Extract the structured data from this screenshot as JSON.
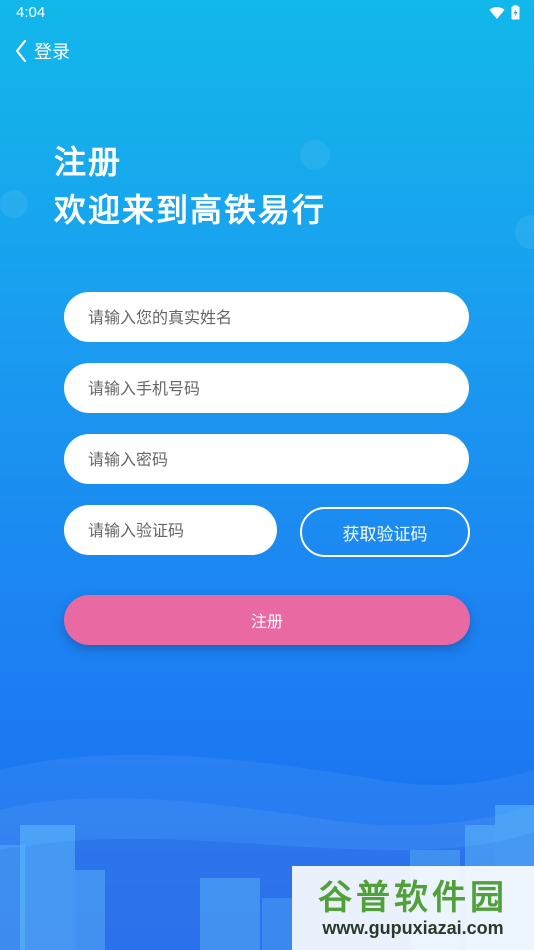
{
  "status_bar": {
    "time": "4:04"
  },
  "nav": {
    "back_label": "登录"
  },
  "heading": {
    "line1": "注册",
    "line2": "欢迎来到高铁易行"
  },
  "form": {
    "name_placeholder": "请输入您的真实姓名",
    "phone_placeholder": "请输入手机号码",
    "password_placeholder": "请输入密码",
    "code_placeholder": "请输入验证码",
    "get_code_label": "获取验证码",
    "submit_label": "注册"
  },
  "watermark": {
    "title": "谷普软件园",
    "url": "www.gupuxiazai.com"
  },
  "colors": {
    "submit": "#e96aa2",
    "background_top": "#12b8ea",
    "background_bottom": "#1a6cf0"
  }
}
